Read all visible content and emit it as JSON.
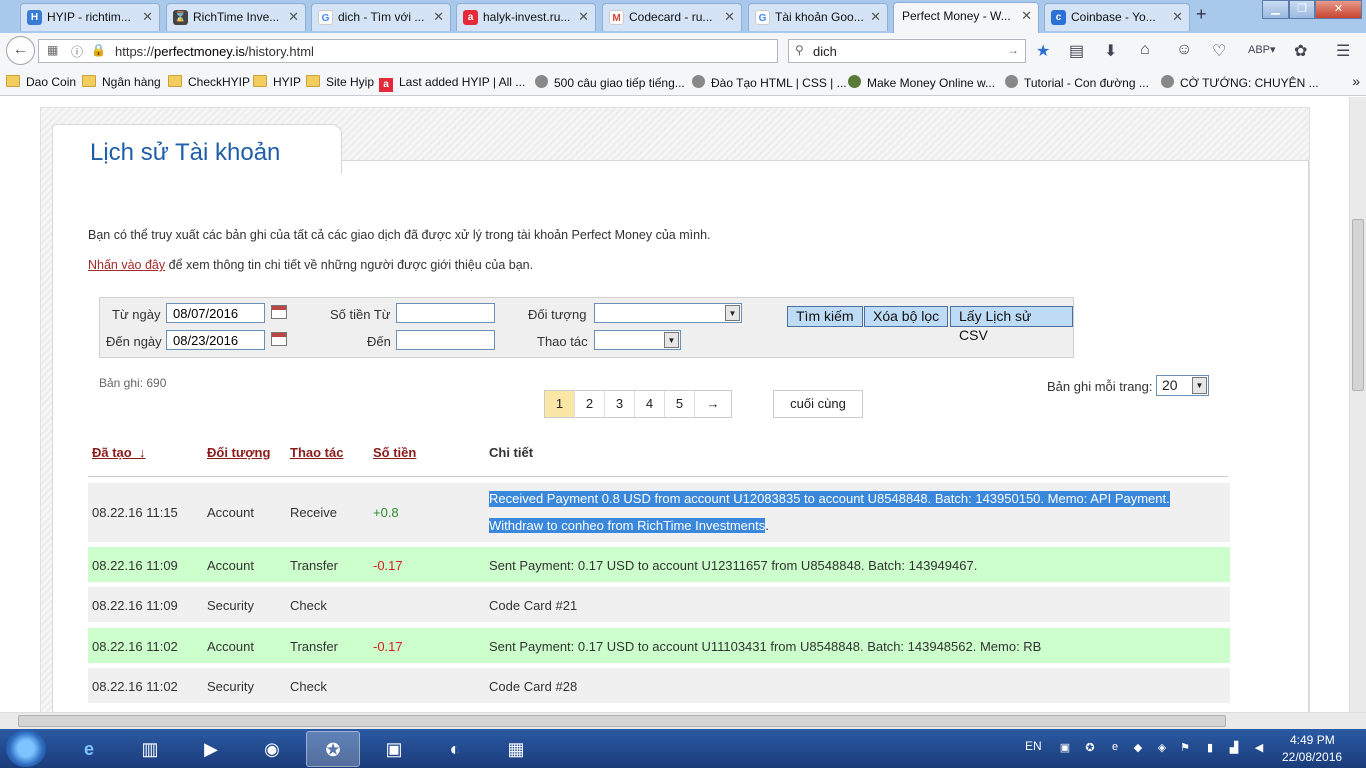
{
  "browser": {
    "tabs": [
      {
        "label": "HYIP - richtim...",
        "favicon": "hyip-icon",
        "color": "#3a7bd5"
      },
      {
        "label": "RichTime Inve...",
        "favicon": "richtime-icon",
        "color": "#444444"
      },
      {
        "label": "dich - Tìm với ...",
        "favicon": "google-icon",
        "color": "#4285f4"
      },
      {
        "label": "halyk-invest.ru...",
        "favicon": "halyk-icon",
        "color": "#e4293a"
      },
      {
        "label": "Codecard - ru...",
        "favicon": "gmail-icon",
        "color": "#d44638"
      },
      {
        "label": "Tài khoản Goo...",
        "favicon": "google-icon",
        "color": "#4285f4"
      },
      {
        "label": "Perfect Money - W...",
        "favicon": "",
        "color": ""
      },
      {
        "label": "Coinbase - Yo...",
        "favicon": "coinbase-icon",
        "color": "#2b71d6"
      }
    ],
    "url_prefix": "https://",
    "url_host": "perfectmoney.is",
    "url_path": "/history.html",
    "search_value": "dich",
    "bookmarks": [
      {
        "label": "Dao Coin",
        "icon": "folder"
      },
      {
        "label": "Ngân hàng",
        "icon": "folder"
      },
      {
        "label": "CheckHYIP",
        "icon": "folder"
      },
      {
        "label": "HYIP",
        "icon": "folder"
      },
      {
        "label": "Site Hyip",
        "icon": "folder"
      },
      {
        "label": "Last added HYIP | All ...",
        "icon": "red"
      },
      {
        "label": "500 câu giao tiếp tiếng...",
        "icon": "globe"
      },
      {
        "label": "Đào Tạo HTML | CSS | ...",
        "icon": "globe"
      },
      {
        "label": "Make Money Online w...",
        "icon": "globe"
      },
      {
        "label": "Tutorial - Con đường ...",
        "icon": "globe"
      },
      {
        "label": "CỜ TƯỚNG: CHUYÊN ...",
        "icon": "globe"
      }
    ]
  },
  "page": {
    "title": "Lịch sử Tài khoản",
    "intro": "Bạn có thể truy xuất các bản ghi của tất cả các giao dịch đã được xử lý trong tài khoản Perfect Money của mình.",
    "ref_link": "Nhấn vào đây",
    "ref_rest": " để xem thông tin chi tiết về những người được giới thiệu của bạn.",
    "filter": {
      "from_date_label": "Từ ngày",
      "from_date": "08/07/2016",
      "to_date_label": "Đến ngày",
      "to_date": "08/23/2016",
      "amount_from_label": "Số tiền Từ",
      "amount_to_label": "Đến",
      "object_label": "Đối tượng",
      "action_label": "Thao tác",
      "search_btn": "Tìm kiếm",
      "clear_btn": "Xóa bộ lọc",
      "csv_btn": "Lấy Lịch sử CSV"
    },
    "records": "Bản ghi: 690",
    "pages": [
      "1",
      "2",
      "3",
      "4",
      "5"
    ],
    "next": "→",
    "last": "cuối cùng",
    "perpage_label": "Bản ghi mỗi trang:",
    "perpage_value": "20",
    "headers": {
      "created": "Đã tạo_↓",
      "object": "Đối tượng",
      "action": "Thao tác",
      "amount": "Số tiền",
      "detail": "Chi tiết"
    },
    "rows": [
      {
        "date": "08.22.16 11:15",
        "object": "Account",
        "action": "Receive",
        "amount": "+0.8",
        "detail": "Received Payment 0.8 USD from account U12083835 to account U8548848. Batch: 143950150. Memo: API Payment.",
        "detail2": "Withdraw to conheo from RichTime Investments"
      },
      {
        "date": "08.22.16 11:09",
        "object": "Account",
        "action": "Transfer",
        "amount": "-0.17",
        "detail": "Sent Payment: 0.17 USD to account U12311657 from U8548848. Batch: 143949467."
      },
      {
        "date": "08.22.16 11:09",
        "object": "Security",
        "action": "Check",
        "amount": "",
        "detail": "Code Card #21"
      },
      {
        "date": "08.22.16 11:02",
        "object": "Account",
        "action": "Transfer",
        "amount": "-0.17",
        "detail": "Sent Payment: 0.17 USD to account U11103431 from U8548848. Batch: 143948562. Memo: RB"
      },
      {
        "date": "08.22.16 11:02",
        "object": "Security",
        "action": "Check",
        "amount": "",
        "detail": "Code Card #28"
      }
    ]
  },
  "taskbar": {
    "lang": "EN",
    "time": "4:49 PM",
    "date": "22/08/2016"
  }
}
